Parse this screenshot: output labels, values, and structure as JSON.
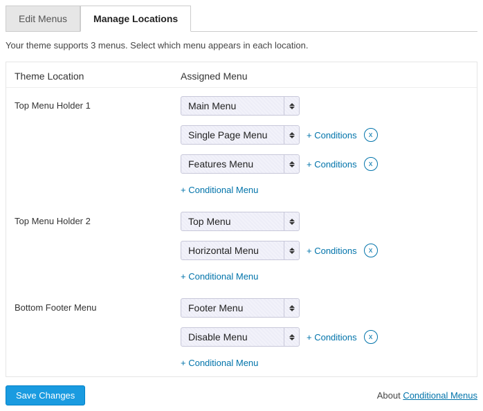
{
  "tabs": {
    "edit": "Edit Menus",
    "manage": "Manage Locations"
  },
  "description": "Your theme supports 3 menus. Select which menu appears in each location.",
  "headers": {
    "location": "Theme Location",
    "assigned": "Assigned Menu"
  },
  "labels": {
    "conditions": "+ Conditions",
    "remove": "x",
    "add_conditional": "+ Conditional Menu",
    "save": "Save Changes",
    "about_prefix": "About ",
    "about_link": "Conditional Menus"
  },
  "locations": [
    {
      "name": "Top Menu Holder 1",
      "primary": "Main Menu",
      "conditionals": [
        "Single Page Menu",
        "Features Menu"
      ]
    },
    {
      "name": "Top Menu Holder 2",
      "primary": "Top Menu",
      "conditionals": [
        "Horizontal Menu"
      ]
    },
    {
      "name": "Bottom Footer Menu",
      "primary": "Footer Menu",
      "conditionals": [
        "Disable Menu"
      ]
    }
  ]
}
